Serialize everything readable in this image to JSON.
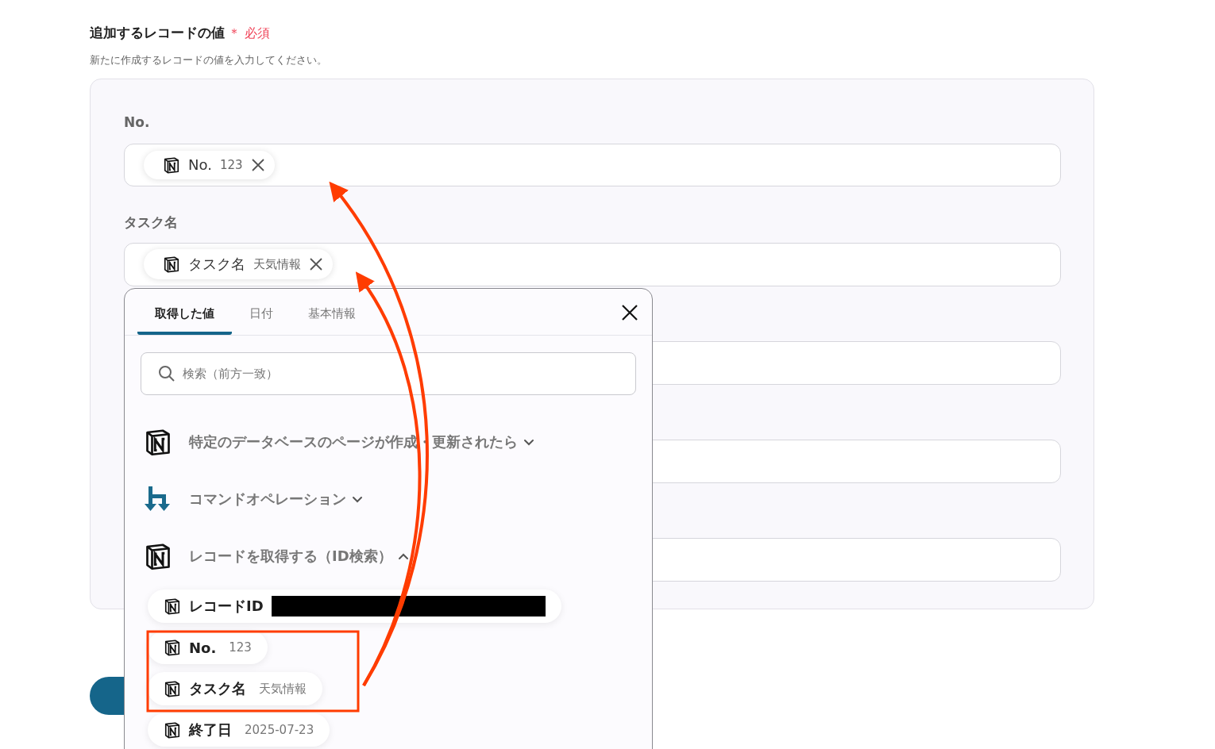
{
  "section": {
    "title": "追加するレコードの値",
    "required_mark": "＊",
    "required_label": "必須",
    "description": "新たに作成するレコードの値を入力してください。"
  },
  "fields": [
    {
      "kind": "token",
      "label": "No.",
      "token": {
        "name": "No.",
        "value": "123"
      }
    },
    {
      "kind": "token",
      "label": "タスク名",
      "token": {
        "name": "タスク名",
        "value": "天気情報"
      }
    },
    {
      "kind": "empty"
    },
    {
      "kind": "empty"
    },
    {
      "kind": "empty"
    }
  ],
  "popup": {
    "tabs": [
      {
        "label": "取得した値",
        "selected": true
      },
      {
        "label": "日付",
        "selected": false
      },
      {
        "label": "基本情報",
        "selected": false
      }
    ],
    "search": {
      "placeholder": "検索（前方一致）"
    },
    "groups": [
      {
        "kind": "notion",
        "title": "特定のデータベースのページが作成・更新されたら",
        "expanded": false
      },
      {
        "kind": "yoom",
        "title": "コマンドオペレーション",
        "expanded": false
      },
      {
        "kind": "notion",
        "title": "レコードを取得する（ID検索）",
        "expanded": true,
        "items": [
          {
            "kind": "redacted",
            "name": "レコードID"
          },
          {
            "kind": "value",
            "name": "No.",
            "value": "123"
          },
          {
            "kind": "value",
            "name": "タスク名",
            "value": "天気情報"
          },
          {
            "kind": "value",
            "name": "終了日",
            "value": "2025-07-23"
          }
        ]
      }
    ]
  }
}
